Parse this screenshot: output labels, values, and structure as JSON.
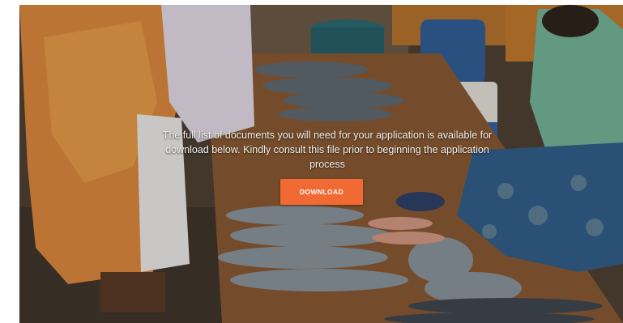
{
  "hero": {
    "message": "The full list of documents you will need for your application is available for download below. Kindly consult this file prior to beginning the application process",
    "download_label": "DOWNLOAD",
    "accent_color": "#f26a33"
  }
}
